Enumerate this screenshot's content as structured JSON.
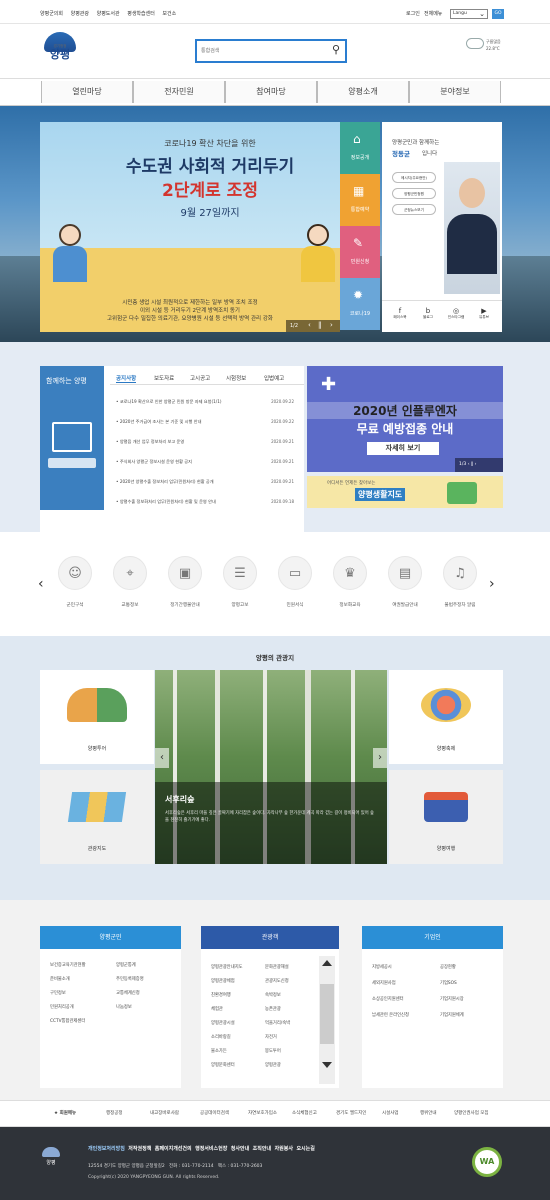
{
  "topbar": {
    "links": [
      "양평군의회",
      "양평관광",
      "양평도서관",
      "평생학습센터",
      "보건소"
    ],
    "login": "로그인",
    "sitemap": "전체메뉴",
    "lang": "Langu",
    "go": "GO"
  },
  "header": {
    "logo_small": "경기청정",
    "logo_main": "양평",
    "search_placeholder": "통합검색",
    "weather": "구름많음",
    "temp": "22.8°C"
  },
  "gnb": [
    "열린마당",
    "전자민원",
    "참여마당",
    "양평소개",
    "분야정보"
  ],
  "visual": {
    "title_small": "코로나19 확산 차단을 위한",
    "title_main": "수도권 사회적 거리두기",
    "title_main2": "2단계로 조정",
    "date": "9월 27일까지",
    "desc1": "시민층 생업 시설 최원적으로 제한하는 일부 방역 조치 조정",
    "desc2": "이외 시설 등 거리두기 2단계 방역조치 동기",
    "desc3": "고위험군 다수 밀집한 의료기관, 요양병원 시설 등 선택적 방역 관리 강화",
    "page": "1/2",
    "quick": [
      {
        "label": "정보공개",
        "color": "#3aa595"
      },
      {
        "label": "통합예약",
        "color": "#f0a232"
      },
      {
        "label": "민원신청",
        "color": "#e0607f"
      },
      {
        "label": "코로나19",
        "color": "#6aa6d8"
      }
    ],
    "mayor_greet": "양평군민과 함께하는",
    "mayor_name": "정동균",
    "mayor_suffix": "입니다",
    "mayor_btns": [
      "메시지(주요현안)",
      "양평군민청원",
      "군정뉴스보기"
    ],
    "mayor_icons": [
      "페이스북",
      "블로그",
      "인스타그램",
      "유튜브"
    ]
  },
  "notice": {
    "side_text": "함께하는 양평",
    "tabs": [
      "공지사항",
      "보도자료",
      "고시공고",
      "시험정보",
      "입법예고"
    ],
    "rows": [
      {
        "t": "코로나19 확산으로 인한 양평군 민원 방문 자제 요청(1/1)",
        "d": "2020.09.22"
      },
      {
        "t": "2020년 주거급여 조사는 본 기준 및 시행 안내",
        "d": "2020.09.22"
      },
      {
        "t": "양평읍 개선 업무 정보처리 보고 운영",
        "d": "2020.09.21"
      },
      {
        "t": "주식회사 양평군 정보시설 운영 현황 공지",
        "d": "2020.09.21"
      },
      {
        "t": "2020년 양평수출 정보처리 업무(민원처리) 현황 공개",
        "d": "2020.09.21"
      },
      {
        "t": "양평수출 정보화처리 업무(민원처리) 현황 및 운영 안내",
        "d": "2020.09.18"
      }
    ],
    "promo_title": "2020년 인플루엔자",
    "promo_sub": "무료 예방접종 안내",
    "promo_btn": "자세히 보기",
    "promo_page": "1/3",
    "map_small": "어디서든 언제든 찾아보는",
    "map_main": "양평생활지도"
  },
  "quick_icons": [
    {
      "label": "군민구석",
      "icon": "person-icon",
      "g": "☺"
    },
    {
      "label": "교통정보",
      "icon": "location-icon",
      "g": "⌖"
    },
    {
      "label": "정기간행물안내",
      "icon": "bag-icon",
      "g": "▣"
    },
    {
      "label": "양평고보",
      "icon": "document-icon",
      "g": "☰"
    },
    {
      "label": "민원서식",
      "icon": "folder-icon",
      "g": "▭"
    },
    {
      "label": "정보화교육",
      "icon": "graduation-icon",
      "g": "♛"
    },
    {
      "label": "여권발급안내",
      "icon": "passport-icon",
      "g": "▤"
    },
    {
      "label": "불법주정차 알림",
      "icon": "bell-icon",
      "g": "♫"
    }
  ],
  "tour": {
    "heading": "양평의 관광지",
    "cards": [
      "양평투어",
      "관광지도",
      "양평축제",
      "양평여행"
    ],
    "feature_title": "서후리숲",
    "feature_desc": "서후리숲은 서후리 마을 깊은 골짜기에 자리잡은 숲이다. 자작나무 숲 한가운데 계곡 따라 걷는 길이 정비되어 있어 숲을 천천히 즐기기에 좋다."
  },
  "link_boxes": [
    {
      "title": "양평군민",
      "items": [
        "보건증교육기관현황",
        "양평군통계",
        "준비물소개",
        "주민등록제증명",
        "구민정보",
        "교통체계신청",
        "민원처리공개",
        "나눔정보",
        "CCTV통합관제센터"
      ]
    },
    {
      "title": "관광객",
      "items": [
        "양평관광안내지도",
        "문화관광해설",
        "양평관광체험",
        "관광지도신청",
        "친환경여행",
        "숙박정보",
        "체험관",
        "농촌관광",
        "양평관광시설",
        "먹을거리/숙박",
        "소리바랑길",
        "자전거",
        "불소가든",
        "봉도투어",
        "양평문화센터",
        "양평관광"
      ]
    },
    {
      "title": "기업인",
      "items": [
        "지방세공시",
        "공장현황",
        "세외지원사업",
        "기업SOS",
        "소상공인지원센터",
        "기업지원시장",
        "납세관련 온라인신청",
        "기업지원체계"
      ]
    }
  ],
  "footer_menu": {
    "label": "회원메뉴",
    "items": [
      "행정공정",
      "내고장바로사람",
      "공공데이터검색",
      "자연보호가입소",
      "소식체험신고",
      "경기도 엘드지인",
      "시설사업",
      "행위안내",
      "양평인권사업 모집"
    ]
  },
  "footer": {
    "links": [
      "개인정보처리방침",
      "저작권정책",
      "홈페이지개선건의",
      "행정서비스헌장",
      "청사안내",
      "조직안내",
      "자원봉사",
      "오시는길"
    ],
    "address": "12554 경기도 양평군 양평읍 군청앞길2",
    "tel": "전화 : 031-770-2114",
    "fax": "팩스 : 031-770-2603",
    "copy": "Copyright(c) 2020 YANGPYEONG GUN. All rights Reserved.",
    "logo": "양평",
    "badge": "WA"
  }
}
